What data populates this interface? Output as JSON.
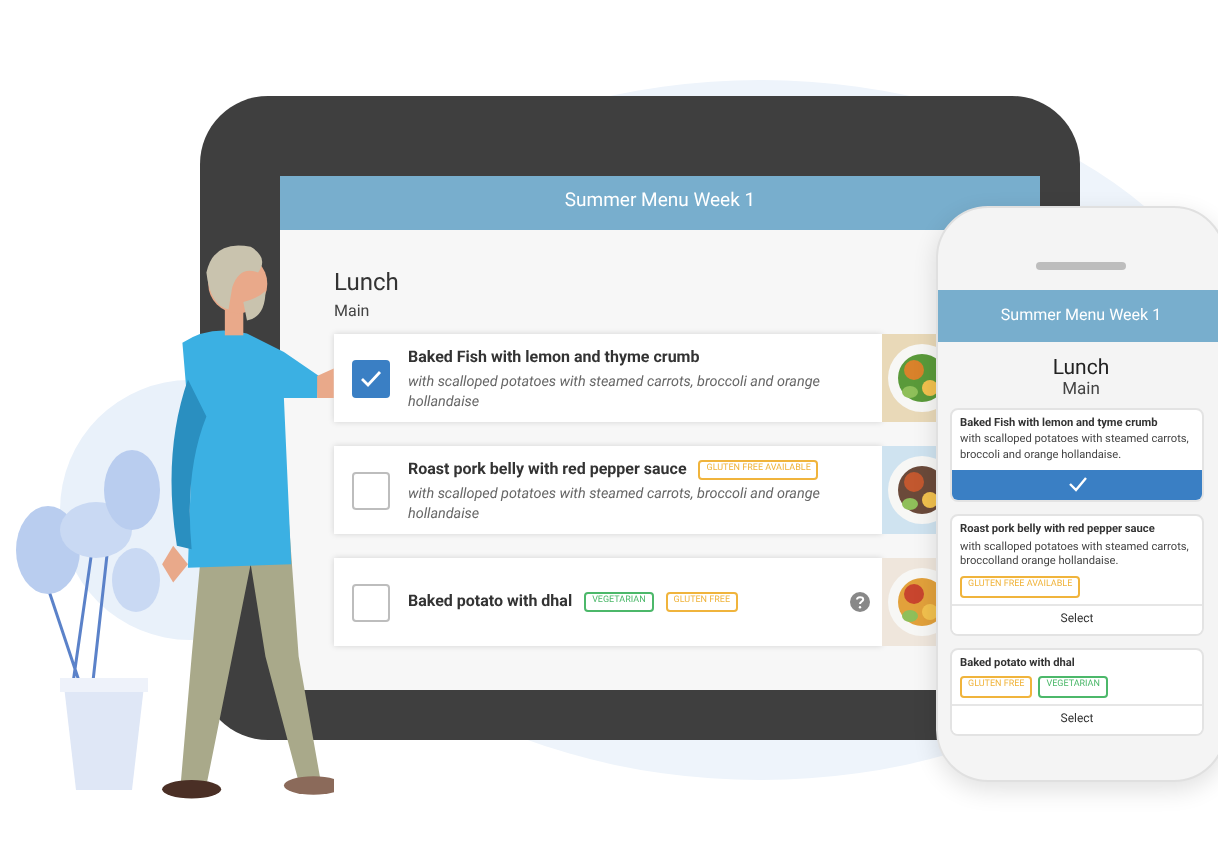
{
  "tablet": {
    "title": "Summer Menu Week 1",
    "meal": "Lunch",
    "course": "Main",
    "dishes": [
      {
        "name": "Baked Fish with lemon and thyme crumb",
        "description": "with scalloped potatoes with steamed carrots, broccoli and orange hollandaise",
        "selected": true,
        "help": false
      },
      {
        "name": "Roast pork belly with red pepper sauce",
        "description": "with scalloped potatoes with steamed carrots, broccoli and orange hollandaise",
        "selected": false,
        "tags": [
          {
            "label": "GLUTEN FREE AVAILABLE",
            "color": "#f0b43c"
          }
        ],
        "help": false
      },
      {
        "name": "Baked potato with dhal",
        "selected": false,
        "tags": [
          {
            "label": "VEGETARIAN",
            "color": "#4cb86a"
          },
          {
            "label": "GLUTEN FREE",
            "color": "#f0b43c"
          }
        ],
        "help": true
      }
    ]
  },
  "phone": {
    "title": "Summer Menu Week 1",
    "meal": "Lunch",
    "course": "Main",
    "dishes": [
      {
        "name": "Baked Fish with lemon and tyme crumb",
        "description": "with scalloped potatoes with steamed carrots, broccoli and orange hollandaise.",
        "selected": true
      },
      {
        "name": "Roast pork belly with red pepper sauce",
        "description": "with scalloped potatoes with steamed carrots, broccolland orange hollandaise.",
        "selected": false,
        "tags": [
          {
            "label": "GLUTEN FREE AVAILABLE",
            "color": "#f0b43c"
          }
        ],
        "action": "Select"
      },
      {
        "name": "Baked potato with dhal",
        "selected": false,
        "tags": [
          {
            "label": "GLUTEN FREE",
            "color": "#f0b43c"
          },
          {
            "label": "VEGETARIAN",
            "color": "#4cb86a"
          }
        ],
        "action": "Select"
      }
    ]
  }
}
